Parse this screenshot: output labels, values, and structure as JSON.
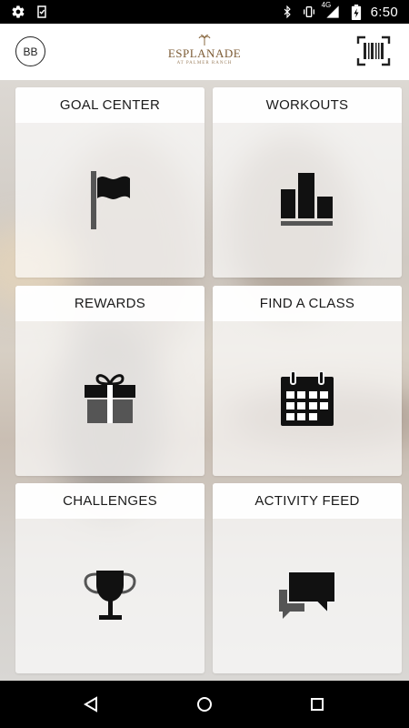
{
  "status_bar": {
    "time": "6:50",
    "network": "4G",
    "icons": [
      "settings-icon",
      "clipboard-check-icon",
      "bluetooth-icon",
      "vibrate-icon",
      "signal-icon",
      "battery-charging-icon"
    ]
  },
  "header": {
    "avatar_initials": "BB",
    "logo": {
      "name": "ESPLANADE",
      "tagline": "AT PALMER RANCH"
    },
    "right_icon": "barcode-scanner-icon"
  },
  "tiles": [
    {
      "label": "GOAL CENTER",
      "icon": "flag-icon"
    },
    {
      "label": "WORKOUTS",
      "icon": "bar-chart-icon"
    },
    {
      "label": "REWARDS",
      "icon": "gift-icon"
    },
    {
      "label": "FIND A CLASS",
      "icon": "calendar-icon"
    },
    {
      "label": "CHALLENGES",
      "icon": "trophy-icon"
    },
    {
      "label": "ACTIVITY FEED",
      "icon": "chat-bubbles-icon"
    }
  ],
  "nav": {
    "icons": [
      "back-icon",
      "home-icon",
      "recents-icon"
    ]
  },
  "colors": {
    "logo": "#8a6a42",
    "tile_bg": "#ffffff",
    "icon": "#111111",
    "icon_secondary": "#555555"
  }
}
